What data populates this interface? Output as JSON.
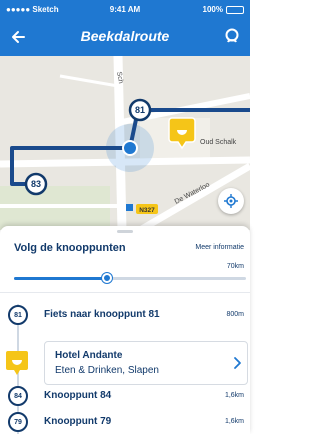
{
  "status_bar": {
    "carrier": "●●●●● Sketch",
    "time": "9:41 AM",
    "battery": "100%"
  },
  "nav": {
    "title": "Beekdalroute",
    "back_icon": "back-arrow-icon",
    "search_icon": "search-icon"
  },
  "map": {
    "labels": {
      "street_top": "Sch",
      "street_right": "Oud Schalk",
      "street_waterloo": "De Waterloo",
      "road_badge": "N327"
    },
    "nodes": [
      "81",
      "83"
    ]
  },
  "sheet": {
    "title": "Volg de knooppunten",
    "more_info": "Meer informatie",
    "total_distance": "70km",
    "progress": 0.4
  },
  "route": {
    "steps": [
      {
        "node": "81",
        "label": "Fiets naar knooppunt 81",
        "distance": "800m"
      },
      {
        "node": "84",
        "label": "Knooppunt 84",
        "distance": "1,6km"
      },
      {
        "node": "79",
        "label": "Knooppunt 79",
        "distance": "1,6km"
      }
    ],
    "poi": {
      "name": "Hotel Andante",
      "category": "Eten & Drinken, Slapen"
    }
  },
  "colors": {
    "brand_blue": "#1f78d1",
    "dark_navy": "#123a6b",
    "poi_yellow": "#f5c518"
  }
}
